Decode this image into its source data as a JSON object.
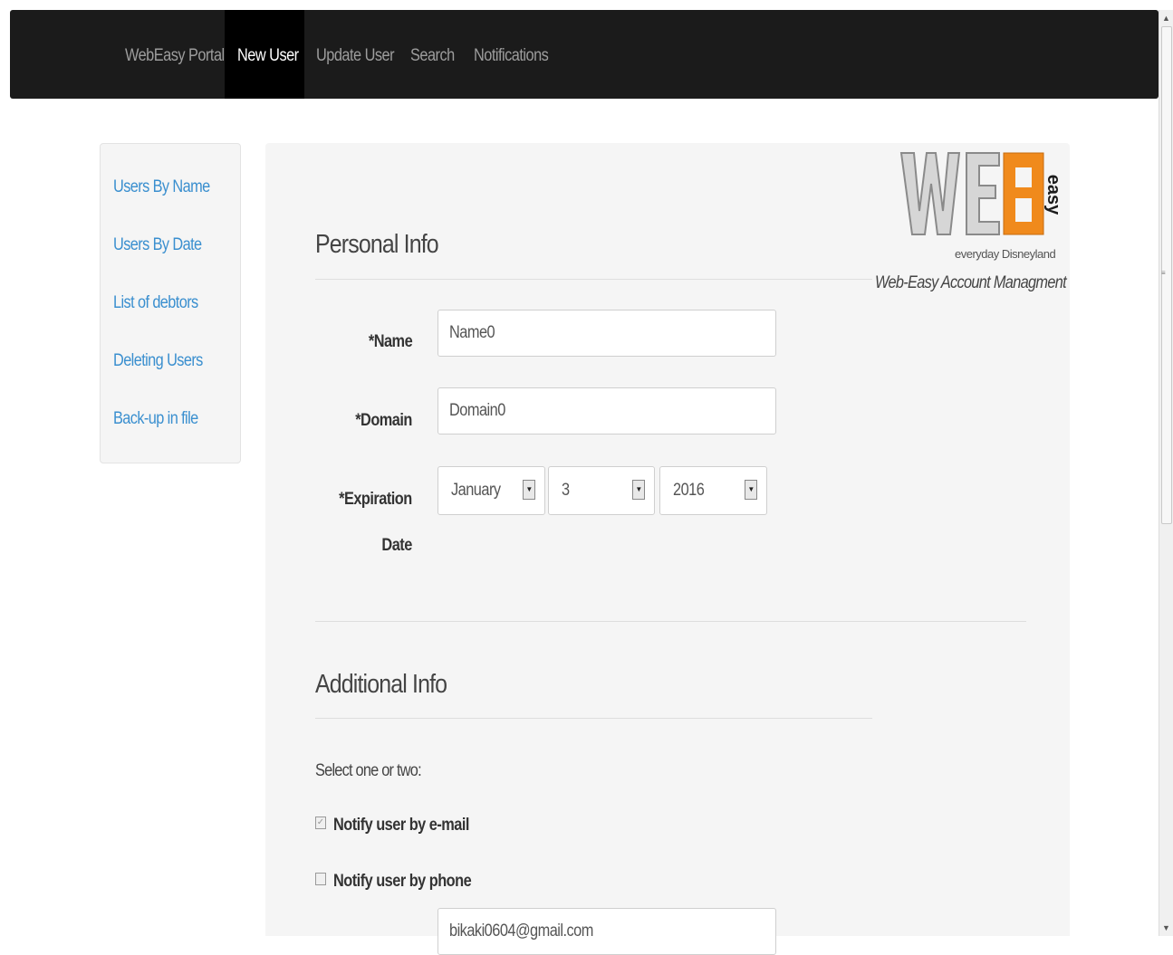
{
  "navbar": {
    "brand": "WebEasy Portal",
    "items": [
      "New User",
      "Update User",
      "Search",
      "Notifications"
    ],
    "active_index": 0
  },
  "sidebar": {
    "items": [
      "Users By Name",
      "Users By Date",
      "List of debtors",
      "Deleting Users",
      "Back-up in file"
    ]
  },
  "logo": {
    "letters": [
      "W",
      "E",
      "B"
    ],
    "vertical_text": "easy",
    "subtitle": "everyday Disneyland",
    "tagline": "Web-Easy Account Managment",
    "accent_color": "#f08a1c"
  },
  "personal_info": {
    "title": "Personal Info",
    "name_label": "*Name",
    "name_value": "Name0",
    "domain_label": "*Domain",
    "domain_value": "Domain0",
    "expiration_label_line1": "*Expiration",
    "expiration_label_line2": "Date",
    "month": "January",
    "day": "3",
    "year": "2016"
  },
  "additional_info": {
    "title": "Additional Info",
    "select_prompt": "Select one or two:",
    "notify_email_label": "Notify user by e-mail",
    "notify_email_checked": true,
    "notify_phone_label": "Notify user by phone",
    "notify_phone_checked": false,
    "email_value": "bikaki0604@gmail.com"
  },
  "colors": {
    "navbar_bg": "#1b1b1b",
    "link": "#3a8fcf",
    "panel_bg": "#f5f5f5"
  }
}
